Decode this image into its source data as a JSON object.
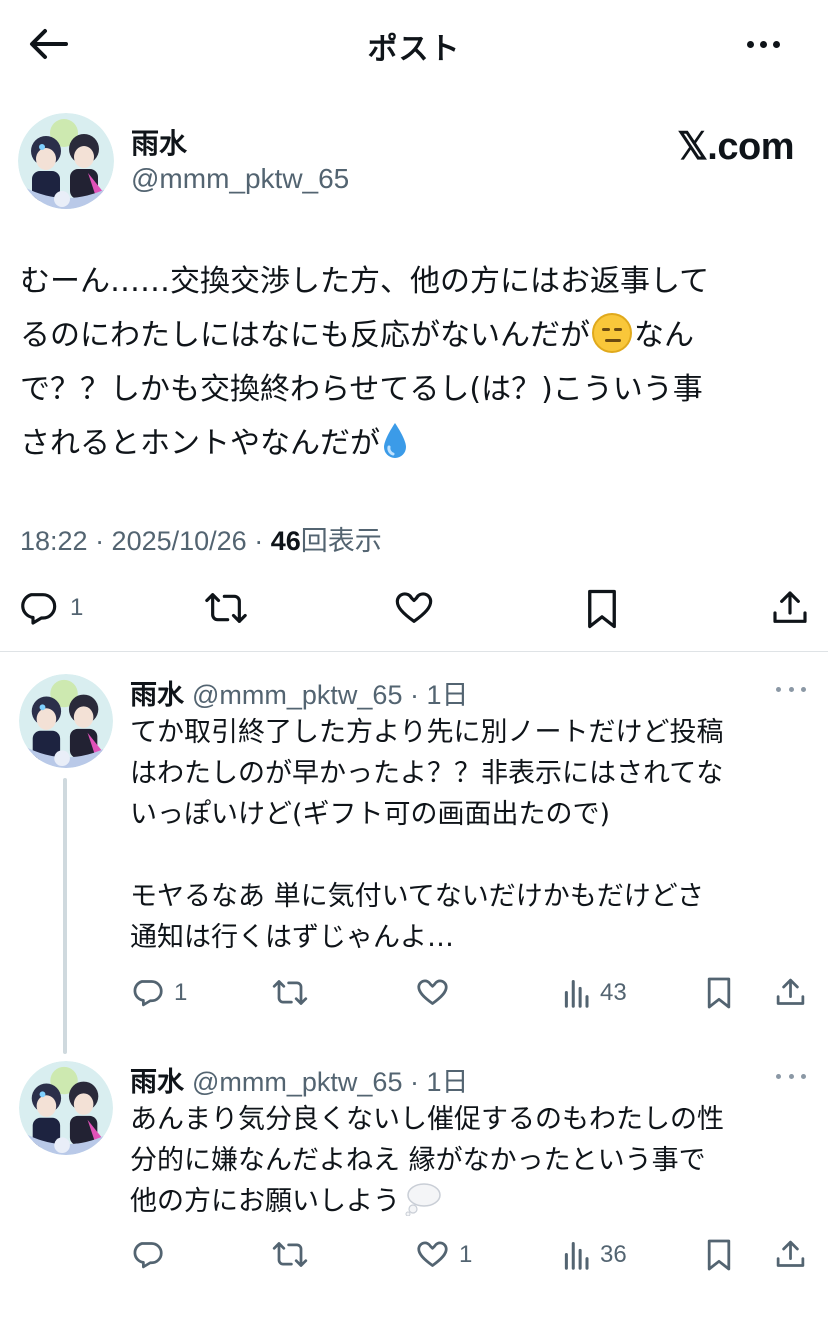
{
  "header": {
    "title": "ポスト"
  },
  "main_post": {
    "author_name": "雨水",
    "author_handle": "@mmm_pktw_65",
    "watermark": "𝕏.com",
    "text_lines": [
      "むーん……交換交渉した方、他の方にはお返事して",
      "るのにわたしにはなにも反応がないんだが",
      "なん",
      "で？？しかも交換終わらせてるし(は？)こういう事",
      "されるとホントやなんだが"
    ],
    "timestamp": "18:22 · 2025/10/26 · ",
    "views_count": "46",
    "views_label": "回表示",
    "reply_count": "1"
  },
  "replies": [
    {
      "author_name": "雨水",
      "meta": "@mmm_pktw_65 · 1日",
      "text_lines": [
        "てか取引終了した方より先に別ノートだけど投稿",
        "はわたしのが早かったよ？？非表示にはされてな",
        "いっぽいけど(ギフト可の画面出たので)",
        "",
        "モヤるなあ  単に気付いてないだけかもだけどさ",
        "通知は行くはずじゃんよ…"
      ],
      "reply_count": "1",
      "retweet_count": "",
      "like_count": "",
      "views_count": "43"
    },
    {
      "author_name": "雨水",
      "meta": "@mmm_pktw_65 · 1日",
      "text_lines": [
        "あんまり気分良くないし催促するのもわたしの性",
        "分的に嫌なんだよねえ 縁がなかったという事で",
        "他の方にお願いしよう"
      ],
      "reply_count": "",
      "retweet_count": "",
      "like_count": "1",
      "views_count": "36"
    }
  ],
  "colors": {
    "text": "#0f1419",
    "secondary": "#536471",
    "divider": "#dfe3e6",
    "thread_line": "#cfd9de"
  },
  "icons": [
    "back-arrow-icon",
    "more-icon",
    "reply-icon",
    "retweet-icon",
    "like-icon",
    "bookmark-icon",
    "share-icon",
    "views-icon",
    "expressionless-face-emoji",
    "droplet-emoji",
    "thought-balloon-emoji"
  ]
}
